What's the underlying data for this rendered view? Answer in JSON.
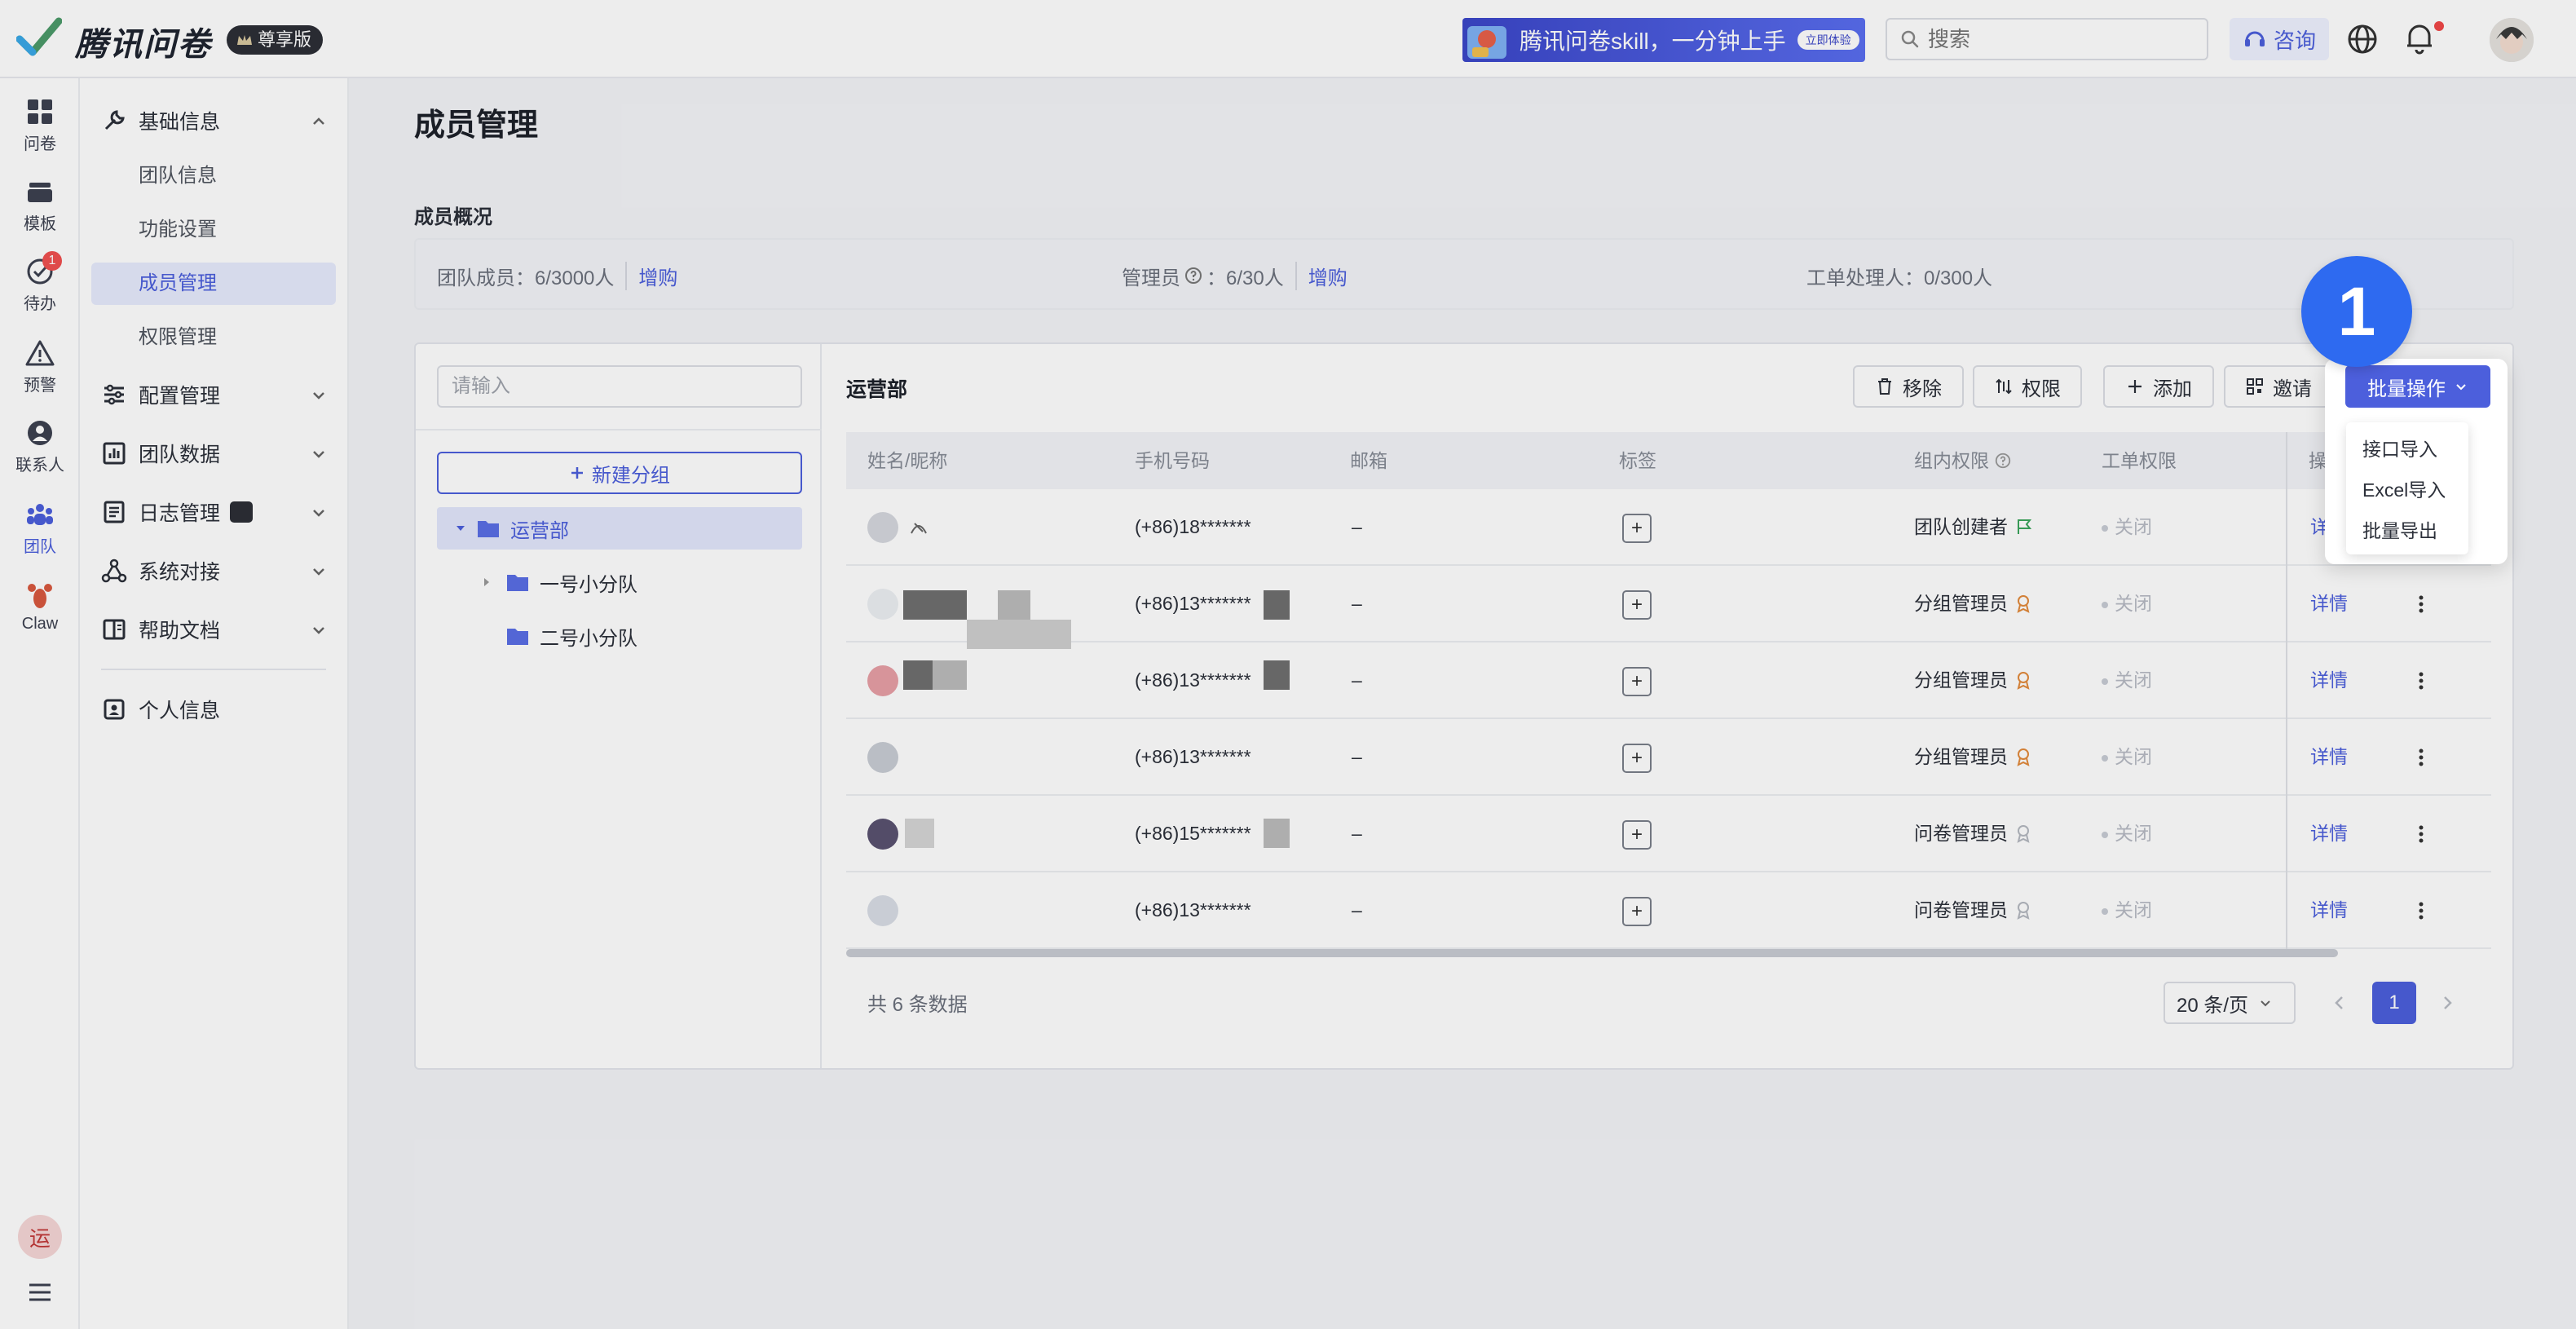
{
  "app": {
    "title": "腾讯问卷",
    "tier": "尊享版"
  },
  "topbar": {
    "banner_text": "腾讯问卷skill，一分钟上手",
    "banner_button": "立即体验",
    "search_placeholder": "搜索",
    "consult_label": "咨询"
  },
  "rail": {
    "items": [
      {
        "label": "问卷",
        "icon": "grid-icon"
      },
      {
        "label": "模板",
        "icon": "template-icon"
      },
      {
        "label": "待办",
        "icon": "check-circle-icon",
        "badge": "1"
      },
      {
        "label": "预警",
        "icon": "warning-icon"
      },
      {
        "label": "联系人",
        "icon": "contact-icon"
      },
      {
        "label": "团队",
        "icon": "team-icon"
      },
      {
        "label": "Claw",
        "icon": "lobster-icon"
      }
    ],
    "user_initial": "运"
  },
  "sidenav": {
    "basic": "基础信息",
    "basic_items": [
      "团队信息",
      "功能设置",
      "成员管理",
      "权限管理"
    ],
    "config": "配置管理",
    "team_data": "团队数据",
    "logs": "日志管理",
    "integration": "系统对接",
    "help": "帮助文档",
    "profile": "个人信息"
  },
  "page": {
    "title": "成员管理",
    "overview_title": "成员概况",
    "team_members": "团队成员：6/3000人",
    "admins_label": "管理员",
    "admins_value": "：6/30人",
    "ticket_handlers": "工单处理人：0/300人",
    "buy_more": "增购"
  },
  "tree": {
    "search_placeholder": "请输入",
    "new_group": "新建分组",
    "nodes": [
      "运营部",
      "一号小分队",
      "二号小分队"
    ]
  },
  "toolbar": {
    "dept": "运营部",
    "remove": "移除",
    "permission": "权限",
    "add": "添加",
    "invite": "邀请",
    "bulk": "批量操作"
  },
  "table": {
    "headers": [
      "姓名/昵称",
      "手机号码",
      "邮箱",
      "标签",
      "组内权限",
      "工单权限",
      "操作"
    ],
    "rows": [
      {
        "phone": "(+86)18*******",
        "email": "–",
        "role": "团队创建者",
        "ticket": "关闭",
        "action": "详情"
      },
      {
        "phone": "(+86)13*******",
        "email": "–",
        "role": "分组管理员",
        "ticket": "关闭",
        "action": "详情"
      },
      {
        "phone": "(+86)13*******",
        "email": "–",
        "role": "分组管理员",
        "ticket": "关闭",
        "action": "详情"
      },
      {
        "phone": "(+86)13*******",
        "email": "–",
        "role": "分组管理员",
        "ticket": "关闭",
        "action": "详情"
      },
      {
        "phone": "(+86)15*******",
        "email": "–",
        "role": "问卷管理员",
        "ticket": "关闭",
        "action": "详情"
      },
      {
        "phone": "(+86)13*******",
        "email": "–",
        "role": "问卷管理员",
        "ticket": "关闭",
        "action": "详情"
      }
    ]
  },
  "pagination": {
    "total": "共 6 条数据",
    "page_size": "20 条/页",
    "current": "1"
  },
  "dropdown": {
    "items": [
      "接口导入",
      "Excel导入",
      "批量导出"
    ]
  },
  "step": "1",
  "colors": {
    "accent": "#4c5fdc",
    "step_badge": "#2e6af0"
  }
}
